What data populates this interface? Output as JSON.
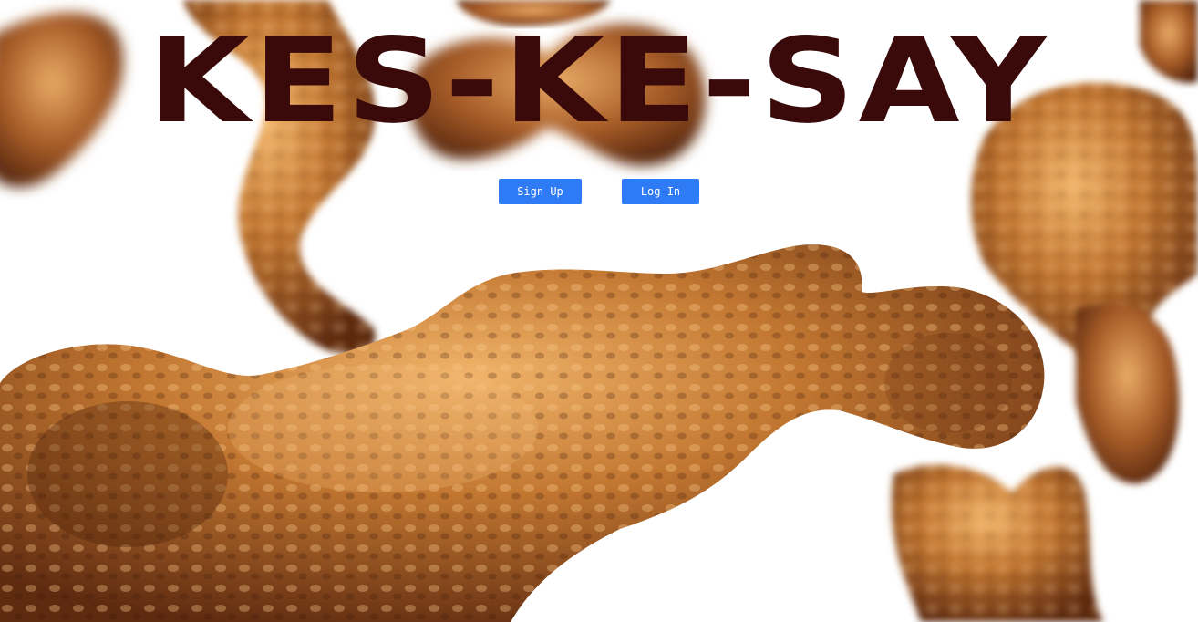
{
  "hero": {
    "title": "KES-KE-SAY"
  },
  "actions": {
    "signup_label": "Sign Up",
    "login_label": "Log In"
  },
  "colors": {
    "title": "#3a0a0b",
    "button": "#2f7bf5",
    "ginger_light": "#e7a15c",
    "ginger_mid": "#b8692c",
    "ginger_dark": "#6b3414"
  },
  "background": {
    "image": "floating-ginger-root-illustration"
  }
}
